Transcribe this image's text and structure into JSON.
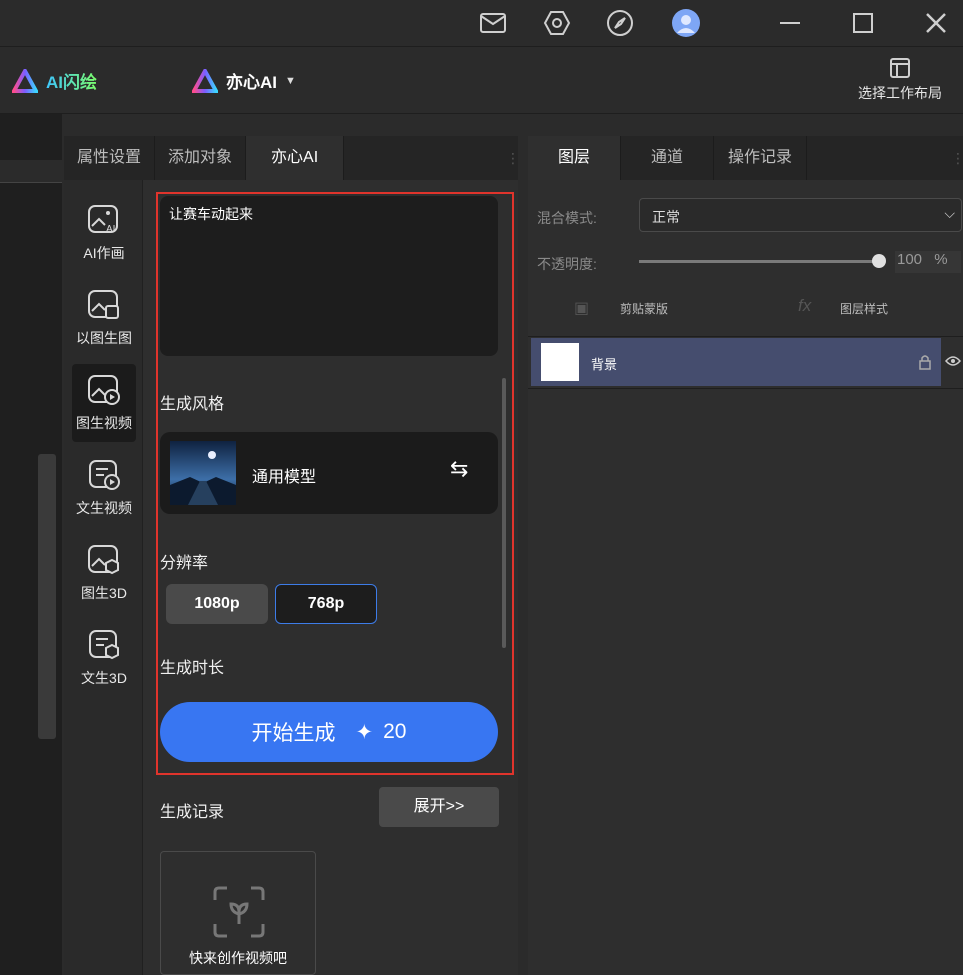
{
  "window": {
    "icons": [
      "mail-icon",
      "settings-hex-icon",
      "compass-icon",
      "user-avatar",
      "minimize-icon",
      "maximize-icon",
      "close-icon"
    ]
  },
  "menubar": {
    "brand1": "AI闪绘",
    "brand2": "亦心AI",
    "layout_button": "选择工作布局"
  },
  "left_panel": {
    "tabs": [
      "属性设置",
      "添加对象",
      "亦心AI"
    ],
    "active_tab": 2,
    "tools": [
      {
        "label": "AI作画",
        "icon": "ai-image-icon"
      },
      {
        "label": "以图生图",
        "icon": "image-to-image-icon"
      },
      {
        "label": "图生视频",
        "icon": "image-to-video-icon"
      },
      {
        "label": "文生视频",
        "icon": "text-to-video-icon"
      },
      {
        "label": "图生3D",
        "icon": "image-to-3d-icon"
      },
      {
        "label": "文生3D",
        "icon": "text-to-3d-icon"
      }
    ],
    "active_tool": 2,
    "prompt_text": "让赛车动起来",
    "style_title": "生成风格",
    "style_model": "通用模型",
    "resolution_title": "分辨率",
    "resolutions": [
      "1080p",
      "768p"
    ],
    "selected_resolution": "768p",
    "duration_title": "生成时长",
    "generate_label": "开始生成",
    "generate_cost": "20",
    "history_title": "生成记录",
    "expand_label": "展开>>",
    "empty_history_text": "快来创作视频吧"
  },
  "right_panel": {
    "tabs": [
      "图层",
      "通道",
      "操作记录"
    ],
    "active_tab": 0,
    "blend_label": "混合模式:",
    "blend_value": "正常",
    "opacity_label": "不透明度:",
    "opacity_value": "100",
    "opacity_unit": "%",
    "opacity_fraction": 1.0,
    "clip_mask": "剪贴蒙版",
    "layer_style": "图层样式",
    "layers": [
      {
        "name": "背景"
      }
    ]
  },
  "colors": {
    "accent": "#3876f2",
    "highlight": "#e0342c",
    "selected_layer": "#454d6e"
  }
}
